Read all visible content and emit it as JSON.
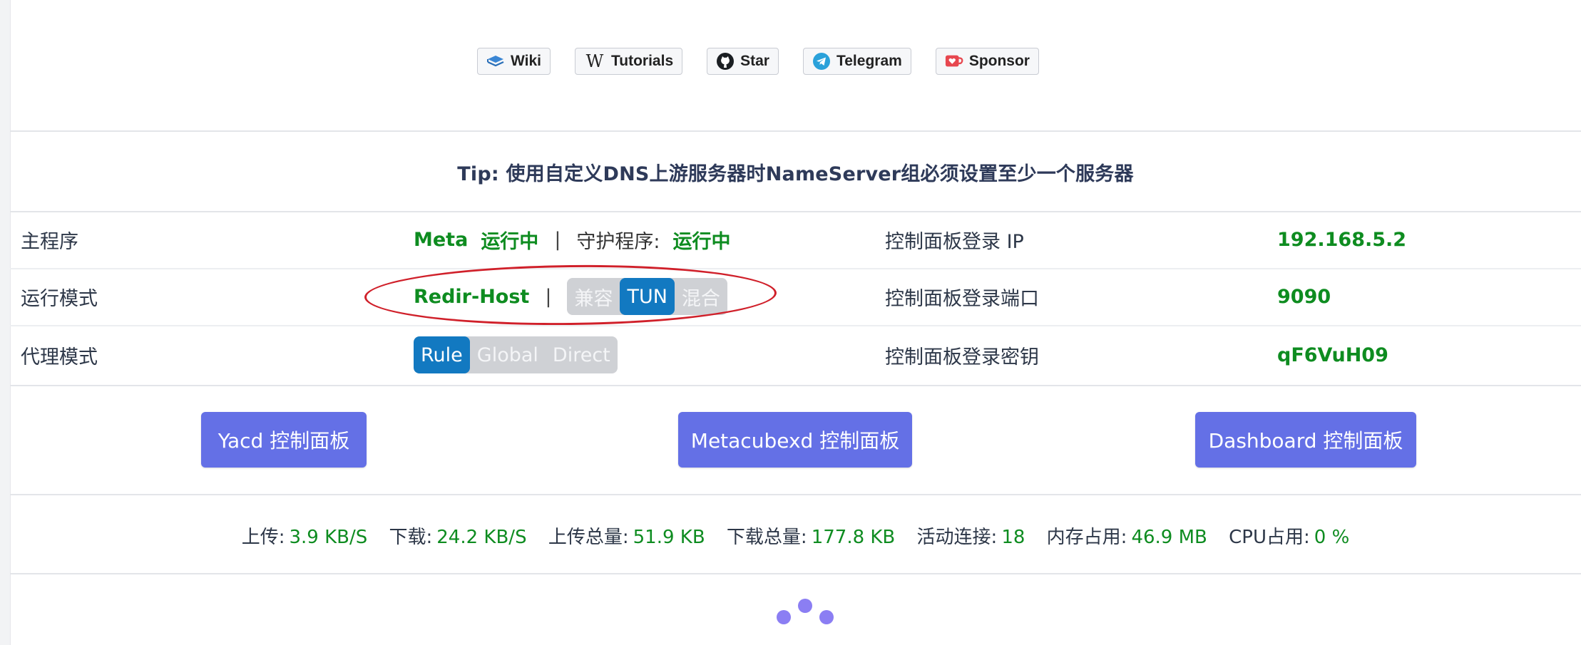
{
  "links": [
    {
      "label": "Wiki",
      "icon": "book-icon"
    },
    {
      "label": "Tutorials",
      "icon": "wikipedia-icon"
    },
    {
      "label": "Star",
      "icon": "github-icon"
    },
    {
      "label": "Telegram",
      "icon": "telegram-icon"
    },
    {
      "label": "Sponsor",
      "icon": "kofi-cup-icon"
    }
  ],
  "tip": "Tip: 使用自定义DNS上游服务器时NameServer组必须设置至少一个服务器",
  "status": {
    "main_label": "主程序",
    "core_name": "Meta",
    "core_state": "运行中",
    "separator": "|",
    "guard_label": "守护程序:",
    "guard_state": "运行中",
    "ip_label": "控制面板登录 IP",
    "ip_value": "192.168.5.2"
  },
  "run_mode": {
    "label": "运行模式",
    "value": "Redir-Host",
    "separator": "|",
    "options": [
      "兼容",
      "TUN",
      "混合"
    ],
    "selected": "TUN",
    "port_label": "控制面板登录端口",
    "port_value": "9090"
  },
  "proxy_mode": {
    "label": "代理模式",
    "options": [
      "Rule",
      "Global",
      "Direct"
    ],
    "selected": "Rule",
    "secret_label": "控制面板登录密钥",
    "secret_value": "qF6VuH09"
  },
  "dashboards": [
    {
      "label": "Yacd 控制面板"
    },
    {
      "label": "Metacubexd 控制面板"
    },
    {
      "label": "Dashboard 控制面板"
    }
  ],
  "stats": [
    {
      "label": "上传:",
      "value": "3.9 KB/S"
    },
    {
      "label": "下载:",
      "value": "24.2 KB/S"
    },
    {
      "label": "上传总量:",
      "value": "51.9 KB"
    },
    {
      "label": "下载总量:",
      "value": "177.8 KB"
    },
    {
      "label": "活动连接:",
      "value": "18"
    },
    {
      "label": "内存占用:",
      "value": "46.9 MB"
    },
    {
      "label": "CPU占用:",
      "value": "0 %"
    }
  ],
  "colors": {
    "accent_green": "#0e8c20",
    "active_blue": "#1279c1",
    "dashboard_button": "#6470e6",
    "annotation_red": "#d0202a",
    "loader": "#8b7ef3"
  }
}
